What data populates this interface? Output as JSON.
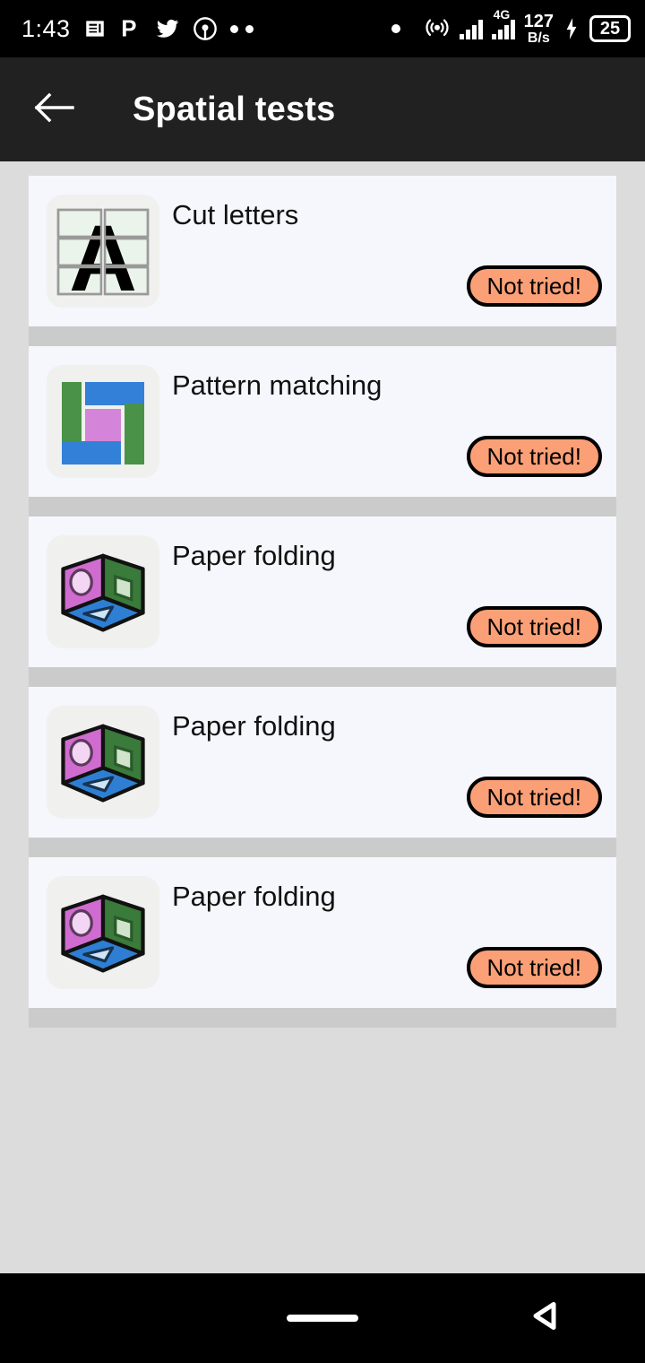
{
  "status_bar": {
    "time": "1:43",
    "left_icons": [
      "news-article-icon",
      "pocket-p-icon",
      "twitter-bird-icon",
      "broadcast-icon",
      "more-dots-icon"
    ],
    "right_icons": [
      "dot-indicator-icon",
      "hotspot-icon",
      "signal-bars-icon",
      "signal-bars-4g-icon",
      "charging-bolt-icon"
    ],
    "network_type": "4G",
    "net_speed_value": "127",
    "net_speed_unit": "B/s",
    "battery_percent": "25"
  },
  "app_bar": {
    "back_icon": "arrow-left-icon",
    "title": "Spatial tests"
  },
  "colors": {
    "page_background": "#dcdcdc",
    "card_background": "#f6f7fc",
    "separator": "#cbcbcb",
    "appbar_background": "#212121",
    "badge_fill": "#fb9f76",
    "badge_border": "#000000",
    "tile_background": "#f0f0ee",
    "icon_green": "#4a9248",
    "icon_blue": "#3380d8",
    "icon_pink": "#d585d9",
    "cube_left": "#d06cd0",
    "cube_right": "#3a7a3a",
    "cube_bottom": "#2e7fd4",
    "grid_cell": "#eaf4ea"
  },
  "tests": [
    {
      "title": "Cut letters",
      "icon": "cut-letters-icon",
      "status": "Not tried!"
    },
    {
      "title": "Pattern matching",
      "icon": "pattern-matching-icon",
      "status": "Not tried!"
    },
    {
      "title": "Paper folding",
      "icon": "paper-folding-cube-icon",
      "status": "Not tried!"
    },
    {
      "title": "Paper folding",
      "icon": "paper-folding-cube-icon",
      "status": "Not tried!"
    },
    {
      "title": "Paper folding",
      "icon": "paper-folding-cube-icon",
      "status": "Not tried!"
    }
  ],
  "nav_bar": {
    "home_icon": "home-pill-icon",
    "back_icon": "nav-back-triangle-icon"
  }
}
